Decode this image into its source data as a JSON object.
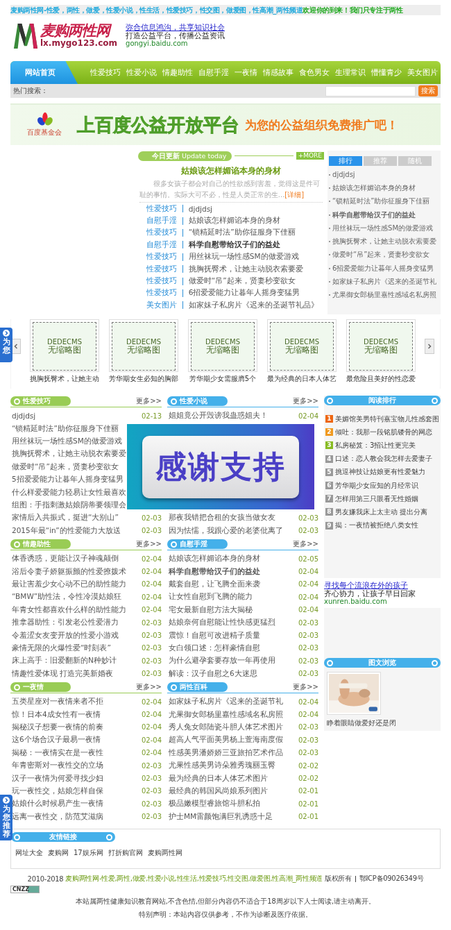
{
  "top_bar": {
    "title": "麦购两性网-性爱，两性，做爱，性爱小说，性生活，性爱技巧，性交图，做爱图，性高潮_两性频道",
    "welcome": "欢迎你的到来！我们只专注于两性"
  },
  "header": {
    "logo_text": "麦购两性网",
    "logo_url": "lx.mygo123.com",
    "ad": {
      "link": "弥合信息鸿沟，共享知识社会",
      "slogan": "打造公益平台，传播公益资讯",
      "url": "gongyi.baidu.com"
    }
  },
  "nav": {
    "items": [
      {
        "label": "网站首页",
        "selected": true
      },
      {
        "label": "性爱技巧",
        "selected": false
      },
      {
        "label": "性爱小说",
        "selected": false
      },
      {
        "label": "情趣助性",
        "selected": false
      },
      {
        "label": "自慰手淫",
        "selected": false
      },
      {
        "label": "一夜情",
        "selected": false
      },
      {
        "label": "情感故事",
        "selected": false
      },
      {
        "label": "食色男女",
        "selected": false
      },
      {
        "label": "生理常识",
        "selected": false
      },
      {
        "label": "懵懂青少",
        "selected": false
      },
      {
        "label": "美女图片",
        "selected": false
      }
    ]
  },
  "search": {
    "label": "热门搜索：",
    "button": "搜索"
  },
  "banner": {
    "org": "百度基金会",
    "headline": "上百度公益开放平台",
    "tagline": "为您的公益组织免费推广吧！"
  },
  "today": {
    "title": "今日更新",
    "subtitle": "Update today",
    "more": "+MORE",
    "headline": "姑娘该怎样媚谄本身的身材",
    "summary": "很多女孩子都会对自己的性欲感到害羞，觉得这是件可耻的事情。实际大可不必，性是人类正常的生...",
    "detail_link": "[详细]",
    "items": [
      {
        "category": "性爱技巧",
        "title": "djdjdsj",
        "bold": false
      },
      {
        "category": "自慰手淫",
        "title": "姑娘该怎样媚谄本身的身材",
        "bold": false
      },
      {
        "category": "性爱技巧",
        "title": "“锁精延时法”助你征服身下佳丽",
        "bold": false
      },
      {
        "category": "自慰手淫",
        "title": "科学自慰带给汉子们的益处",
        "bold": true
      },
      {
        "category": "性爱技巧",
        "title": "用丝袜玩一场性感SM的做爱游戏",
        "bold": false
      },
      {
        "category": "性爱技巧",
        "title": "挑胸抚臀术，让她主动脱衣索要爱",
        "bold": false
      },
      {
        "category": "性爱技巧",
        "title": "做爱时“吊”起来，贤妻秒变欲女",
        "bold": false
      },
      {
        "category": "性爱技巧",
        "title": "6招爱爱能力让暮年人摇身变猛男",
        "bold": false
      },
      {
        "category": "美女图片",
        "title": "如家妹子私房片《迟来的圣诞节礼品》",
        "bold": false
      }
    ]
  },
  "ranking_tabs": {
    "tabs": [
      {
        "label": "排行",
        "selected": true
      },
      {
        "label": "推荐",
        "selected": false
      },
      {
        "label": "随机",
        "selected": false
      }
    ],
    "items": [
      {
        "title": "djdjdsj",
        "bold": false
      },
      {
        "title": "姑娘该怎样媚谄本身的身材",
        "bold": false
      },
      {
        "title": "“锁精延时法”助你征服身下佳丽",
        "bold": false
      },
      {
        "title": "科学自慰带给汉子们的益处",
        "bold": true
      },
      {
        "title": "用丝袜玩一场性感SM的做爱游戏",
        "bold": false
      },
      {
        "title": "挑胸抚臀术，让她主动脱衣索要爱",
        "bold": false
      },
      {
        "title": "做爱时“吊”起来，贤妻秒变欲女",
        "bold": false
      },
      {
        "title": "6招爱爱能力让暮年人摇身变猛男",
        "bold": false
      },
      {
        "title": "如家妹子私房片《迟来的圣诞节礼",
        "bold": false
      },
      {
        "title": "尤果御女郎杨里嘉性感域名私房照",
        "bold": false
      }
    ]
  },
  "carousel": {
    "items": [
      {
        "placeholder_line1": "DEDECMS",
        "placeholder_line2": "无缩略图",
        "caption": "挑胸抚臀术，让她主动"
      },
      {
        "placeholder_line1": "DEDECMS",
        "placeholder_line2": "无缩略图",
        "caption": "芳华期女生必知的胸部"
      },
      {
        "placeholder_line1": "DEDECMS",
        "placeholder_line2": "无缩略图",
        "caption": "芳华期少女需服膺5个"
      },
      {
        "placeholder_line1": "DEDECMS",
        "placeholder_line2": "无缩略图",
        "caption": "最为经典的日本人体艺"
      },
      {
        "placeholder_line1": "DEDECMS",
        "placeholder_line2": "无缩略图",
        "caption": "最危险且美好的性恋爱"
      }
    ]
  },
  "side_tabs": [
    {
      "label": "为您"
    },
    {
      "label": "为您推荐"
    }
  ],
  "columns": [
    [
      {
        "title": "性爱技巧",
        "more": "更多>>",
        "color": "#99cc55",
        "items": [
          {
            "title": "djdjdsj",
            "date": "02-13"
          },
          {
            "title": "“锁精延时法”助你征服身下佳丽"
          },
          {
            "title": "用丝袜玩一场性感SM的做爱游戏"
          },
          {
            "title": "挑胸抚臀术，让她主动脱衣索要爱"
          },
          {
            "title": "做爱时“吊”起来，贤妻秒变欲女"
          },
          {
            "title": "5招爱爱能力让暮年人摇身变猛男"
          },
          {
            "title": "什么样爱爱能力轻易让女性最喜欢"
          },
          {
            "title": "组图：手指刺激姑娘阴蒂要领理会"
          },
          {
            "title": "家情后入共振式，挺进“大别山”",
            "date": "02-03"
          },
          {
            "title": "2015年最“in”的性爱能力大放送",
            "date": "02-03"
          }
        ]
      },
      {
        "title": "情趣助性",
        "more": "更多>>",
        "color": "#99cc55",
        "items": [
          {
            "title": "体香诱惑，更能让汉子神魂颠倒",
            "date": "02-04"
          },
          {
            "title": "浴后令妻子娇躯振颤的性爱撩拨术",
            "date": "02-04"
          },
          {
            "title": "最让害羞少女心动不已的助性能力",
            "date": "02-04"
          },
          {
            "title": "“BMW”助性法，令性冷漠姑娘狂",
            "date": "02-04"
          },
          {
            "title": "年青女性都喜欢什么样的助性能力",
            "date": "02-04"
          },
          {
            "title": "推拿器助性：引发老公性爱潜力",
            "date": "02-03"
          },
          {
            "title": "令羞涩女友变开放的性爱小游戏",
            "date": "02-03"
          },
          {
            "title": "豪情无限的火爆性爱“时刻表”",
            "date": "02-03"
          },
          {
            "title": "床上高手：旧爱翻新的N种妙计",
            "date": "02-03"
          },
          {
            "title": "情趣性爱体现 打造完美新婚夜",
            "date": "02-03"
          }
        ]
      },
      {
        "title": "一夜情",
        "more": "更多>>",
        "color": "#99cc55",
        "items": [
          {
            "title": "五类星座对一夜情来者不拒",
            "date": "02-04"
          },
          {
            "title": "惊！日本4成女性有一夜情",
            "date": "02-04"
          },
          {
            "title": "揭秘汉子想要一夜情的前奏",
            "date": "02-04"
          },
          {
            "title": "这6个场合汉子最易一夜情",
            "date": "02-04"
          },
          {
            "title": "揭秘：一夜情实在是一夜性",
            "date": "02-04"
          },
          {
            "title": "年青密斯对一夜性交的立场",
            "date": "02-03"
          },
          {
            "title": "汉子一夜情为何爱寻找少妇",
            "date": "02-03"
          },
          {
            "title": "玩一夜性交，姑娘怎样自保",
            "date": "02-03"
          },
          {
            "title": "姑娘什么时候易产生一夜情",
            "date": "02-03"
          },
          {
            "title": "远离一夜性交，防范艾滋病",
            "date": "02-03"
          }
        ]
      }
    ],
    [
      {
        "title": "性爱小说",
        "more": "更多>>",
        "color": "#44b0ea",
        "overlay": {
          "text": "感谢支持"
        },
        "items": [
          {
            "title": "姐姐竟公开毁谤我蛊惑姐夫！",
            "date": "02-04"
          },
          {
            "title": "那夜我错把合租的女孩当做女友",
            "date": "02-03"
          },
          {
            "title": "因为怯懦，我跟心爱的老婆仳离了",
            "date": "02-03"
          }
        ]
      },
      {
        "title": "自慰手淫",
        "more": "更多>>",
        "color": "#44b0ea",
        "items": [
          {
            "title": "姑娘该怎样媚谄本身的身材",
            "date": "02-05"
          },
          {
            "title": "科学自慰带给汉子们的益处",
            "date": "02-04",
            "bold": true
          },
          {
            "title": "戴套自慰，让飞腾全面来袭",
            "date": "02-04"
          },
          {
            "title": "让女性自慰到飞腾的能力",
            "date": "02-04"
          },
          {
            "title": "宅女最新自慰方法大揭秘",
            "date": "02-04"
          },
          {
            "title": "姑娘奈何自慰能让性快感更猛烈",
            "date": "02-03"
          },
          {
            "title": "震惊！自慰可改进精子质量",
            "date": "02-03"
          },
          {
            "title": "女白领口述：怎样豪情自慰",
            "date": "02-03"
          },
          {
            "title": "为什么避孕套要存放一年再使用",
            "date": "02-03"
          },
          {
            "title": "解读：汉子自慰之6大迷思",
            "date": "02-03"
          }
        ]
      },
      {
        "title": "两性百科",
        "more": "更多>>",
        "color": "#44b0ea",
        "items": [
          {
            "title": "如家妹子私房片《迟来的圣诞节礼",
            "date": "02-04"
          },
          {
            "title": "尤果御女郎杨里嘉性感域名私房照",
            "date": "02-04"
          },
          {
            "title": "秀人兔女郎陆瓷斗胆人体艺术图片",
            "date": "02-03"
          },
          {
            "title": "超高人气平面美男杨上萱海南度假",
            "date": "02-03"
          },
          {
            "title": "性感美男潘娇娇三亚旅拍艺术作品",
            "date": "02-03"
          },
          {
            "title": "尤果性感美男诗朵雅秀瑰丽玉臀",
            "date": "02-02"
          },
          {
            "title": "最为经典的日本人体艺术图片",
            "date": "02-02"
          },
          {
            "title": "最经典的韩国风尚娘系列图片",
            "date": "02-01"
          },
          {
            "title": "极品嫩模型睿旅馆斗胆私拍",
            "date": "02-01"
          },
          {
            "title": "护士MM雷颜饱满巨乳诱惑十足",
            "date": "02-01"
          }
        ]
      }
    ]
  ],
  "sidebar": {
    "reading": {
      "title": "阅读排行",
      "items": [
        {
          "rank": "1",
          "title": "美媚馆美男特刊嘉宝物儿性感套图",
          "color": "#ee6611"
        },
        {
          "rank": "2",
          "title": "倾吐：我那一段铭肌镂骨的网恋",
          "color": "#f09a20"
        },
        {
          "rank": "3",
          "title": "私房秘笈：3招让性更完美",
          "color": "#88bb22"
        },
        {
          "rank": "4",
          "title": "口述：恋人教会我怎样去爱妻子",
          "color": "#999999"
        },
        {
          "rank": "5",
          "title": "挑逗神技让姑娘更有性爱魅力",
          "color": "#999999"
        },
        {
          "rank": "6",
          "title": "芳华期少女应知的月经常识",
          "color": "#999999"
        },
        {
          "rank": "7",
          "title": "怎样用第三只眼看无性婚姻",
          "color": "#999999"
        },
        {
          "rank": "8",
          "title": "男友嫌我床上太主动 提出分离",
          "color": "#999999"
        },
        {
          "rank": "9",
          "title": "揭：一夜情被拒绝八类女性",
          "color": "#999999"
        }
      ]
    },
    "ad": {
      "link": "寻找每个流浪在外的孩子",
      "slogan": "齐心协力，让孩子早日回家",
      "url": "xunren.baidu.com"
    },
    "gallery": {
      "title": "图文浏览",
      "caption": "睁着眼睛做爱好还是闭"
    }
  },
  "friend_links": {
    "title": "友情链接",
    "links": [
      "网址大全",
      "麦购网",
      "17娱乐网",
      "打折购官网",
      "麦购两性网"
    ]
  },
  "footer": {
    "years": "2010-2018",
    "site_link": "麦购两性网-性爱,两性,做爱,性爱小说,性生活,性爱技巧,性交图,做爱图,性高潮_两性频道",
    "rights": "版权所有",
    "icp": "鄂ICP备09026349号",
    "badge": "CNZZ",
    "notice": "本站属两性健康知识教育网站,不含色情,但部分内容仍不适合于18周岁以下人士阅读,请主动离开。",
    "disclaimer": "特别声明：本站内容仅供参考，不作为诊断及医疗依据。"
  }
}
